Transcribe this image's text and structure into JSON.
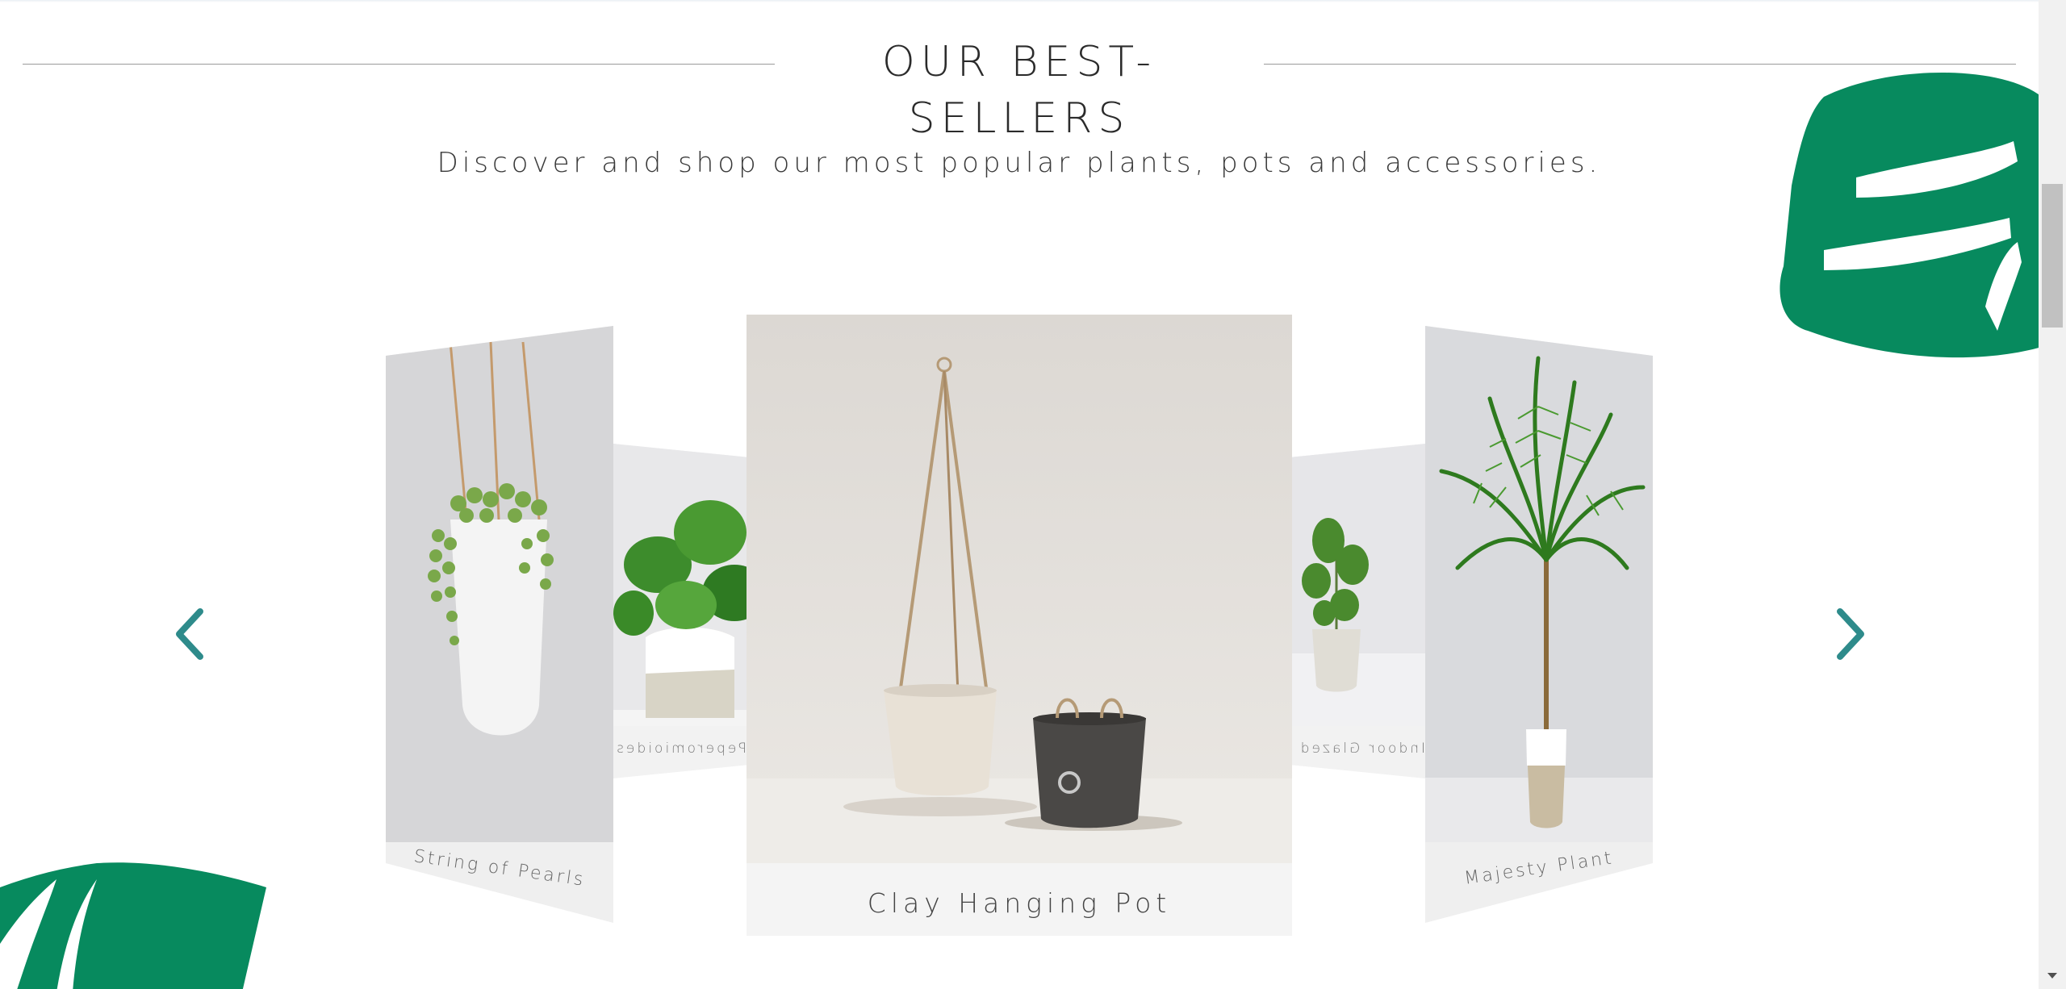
{
  "section": {
    "title": "OUR BEST-SELLERS",
    "subtitle": "Discover and shop our most popular plants, pots and accessories."
  },
  "colors": {
    "accent": "#2e8b8b",
    "leaf": "#078a5e",
    "caption_bg": "#f4f4f4"
  },
  "carousel": {
    "prev_icon": "chevron-left-icon",
    "next_icon": "chevron-right-icon",
    "cards": {
      "center": {
        "label": "Clay Hanging Pot"
      },
      "left": {
        "label": "String of Pearls"
      },
      "right": {
        "label": "Majesty Plant"
      },
      "inner_left": {
        "label": "Peperomioides Plant"
      },
      "inner_right": {
        "label": "Indoor Glazed Pot"
      }
    }
  }
}
